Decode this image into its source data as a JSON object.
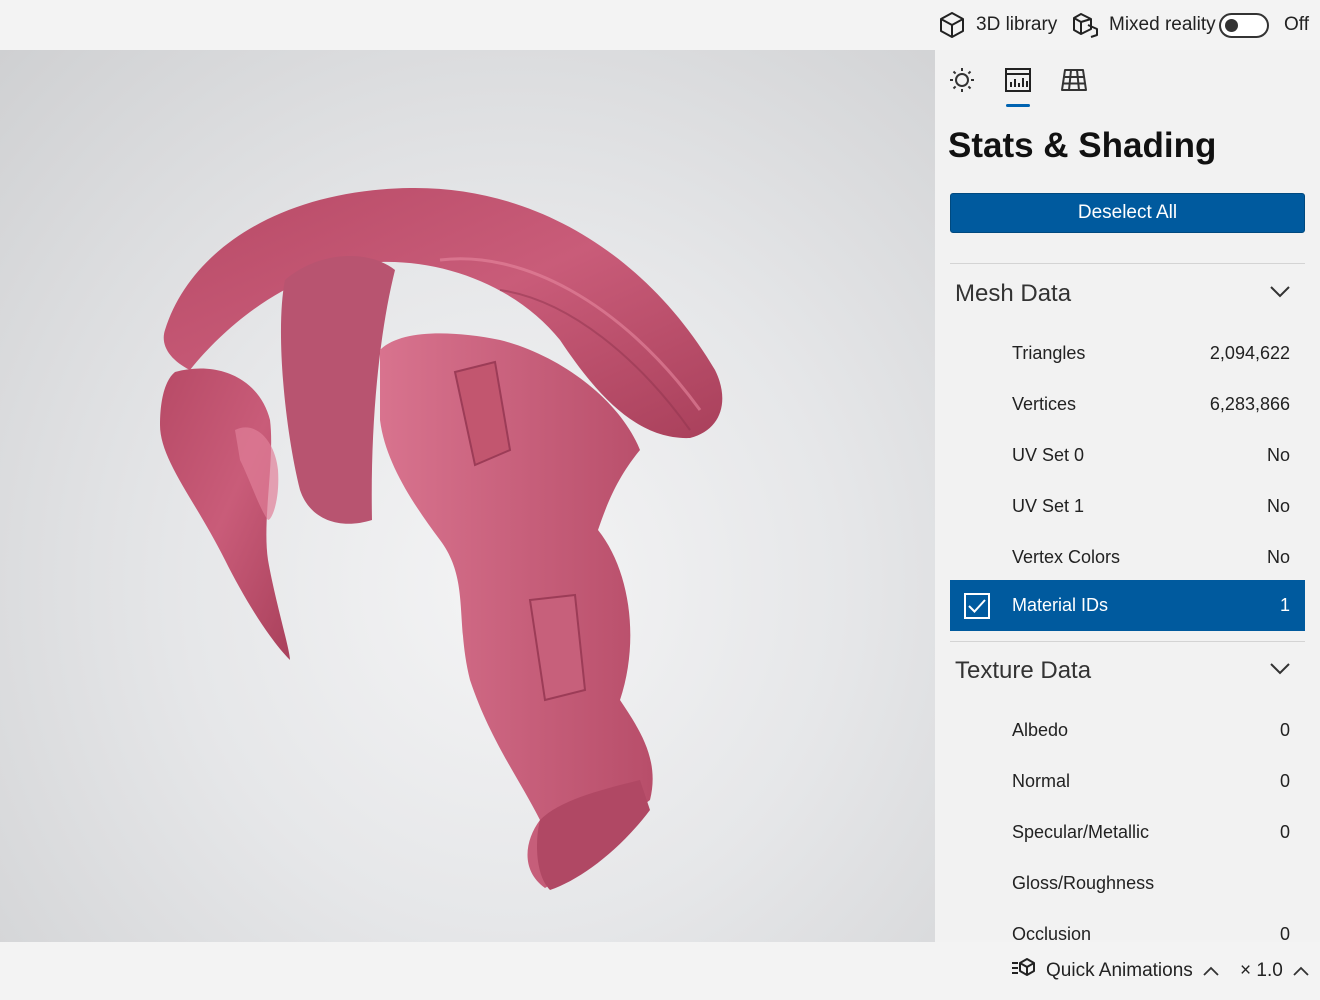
{
  "topbar": {
    "library_label": "3D library",
    "mixed_reality_label": "Mixed reality",
    "mixed_reality_state": "Off"
  },
  "panel": {
    "title": "Stats & Shading",
    "deselect_label": "Deselect All",
    "mesh_section": {
      "label": "Mesh Data",
      "rows": [
        {
          "name": "Triangles",
          "value": "2,094,622"
        },
        {
          "name": "Vertices",
          "value": "6,283,866"
        },
        {
          "name": "UV Set 0",
          "value": "No"
        },
        {
          "name": "UV Set 1",
          "value": "No"
        },
        {
          "name": "Vertex Colors",
          "value": "No"
        },
        {
          "name": "Material IDs",
          "value": "1",
          "selected": true
        }
      ]
    },
    "texture_section": {
      "label": "Texture Data",
      "rows": [
        {
          "name": "Albedo",
          "value": "0"
        },
        {
          "name": "Normal",
          "value": "0"
        },
        {
          "name": "Specular/Metallic",
          "value": "0"
        },
        {
          "name": "Gloss/Roughness",
          "value": ""
        },
        {
          "name": "Occlusion",
          "value": "0"
        }
      ]
    }
  },
  "bottombar": {
    "animations_label": "Quick Animations",
    "speed_label": "× 1.0"
  },
  "colors": {
    "accent": "#005a9e",
    "model": "#c85876"
  }
}
